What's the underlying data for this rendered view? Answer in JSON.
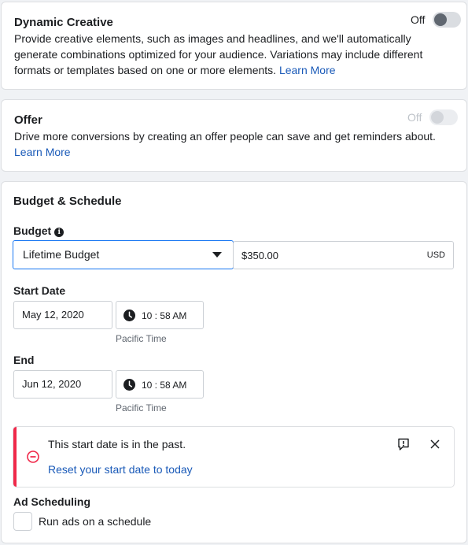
{
  "dynamic_creative": {
    "title": "Dynamic Creative",
    "toggle_label": "Off",
    "description": "Provide creative elements, such as images and headlines, and we'll automatically generate combinations optimized for your audience. Variations may include different formats or templates based on one or more elements.",
    "learn_more": "Learn More"
  },
  "offer": {
    "title": "Offer",
    "toggle_label": "Off",
    "description": "Drive more conversions by creating an offer people can save and get reminders about.",
    "learn_more": "Learn More"
  },
  "budget_schedule": {
    "title": "Budget & Schedule",
    "budget_label": "Budget",
    "info_glyph": "i",
    "budget_type": "Lifetime Budget",
    "budget_amount": "$350.00",
    "currency": "USD",
    "start_label": "Start Date",
    "start_date": "May 12, 2020",
    "start_time": "10 : 58 AM",
    "start_tz": "Pacific Time",
    "end_label": "End",
    "end_date": "Jun 12, 2020",
    "end_time": "10 : 58 AM",
    "end_tz": "Pacific Time",
    "alert": {
      "message": "This start date is in the past.",
      "action": "Reset your start date to today"
    },
    "ad_scheduling_label": "Ad Scheduling",
    "schedule_checkbox_label": "Run ads on a schedule"
  },
  "colors": {
    "link": "#1a5ab8",
    "accent": "#1877f2",
    "error": "#f02849"
  }
}
